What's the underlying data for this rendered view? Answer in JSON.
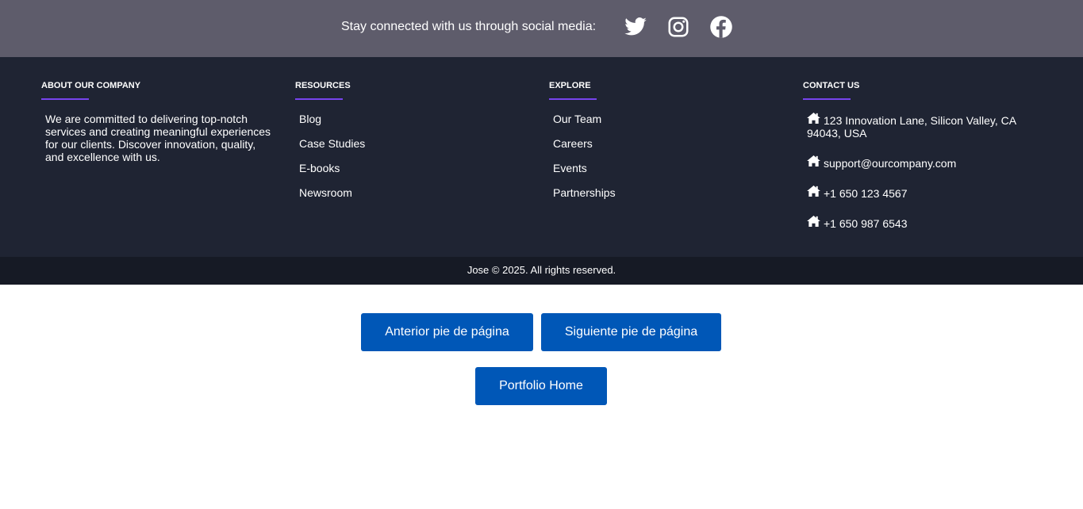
{
  "social": {
    "text": "Stay connected with us through social media:",
    "icons": [
      "twitter-icon",
      "instagram-icon",
      "facebook-icon"
    ]
  },
  "footer": {
    "about": {
      "title": "ABOUT OUR COMPANY",
      "text": "We are committed to delivering top-notch services and creating meaningful experiences for our clients. Discover innovation, quality, and excellence with us."
    },
    "resources": {
      "title": "RESOURCES",
      "links": [
        "Blog",
        "Case Studies",
        "E-books",
        "Newsroom"
      ]
    },
    "explore": {
      "title": "EXPLORE",
      "links": [
        "Our Team",
        "Careers",
        "Events",
        "Partnerships"
      ]
    },
    "contact": {
      "title": "CONTACT US",
      "items": [
        "123 Innovation Lane, Silicon Valley, CA 94043, USA",
        "support@ourcompany.com",
        "+1 650 123 4567",
        "+1 650 987 6543"
      ],
      "icon": "home-icon"
    }
  },
  "copyright": "Jose © 2025. All rights reserved.",
  "nav": {
    "prev_label": "Anterior pie de página",
    "next_label": "Siguiente pie de página",
    "home_label": "Portfolio Home"
  },
  "colors": {
    "social_bar": "#5e5c6b",
    "footer_bg": "#1f2433",
    "copyright_bg": "#161a25",
    "accent": "#7744ee",
    "button": "#0057b7"
  }
}
